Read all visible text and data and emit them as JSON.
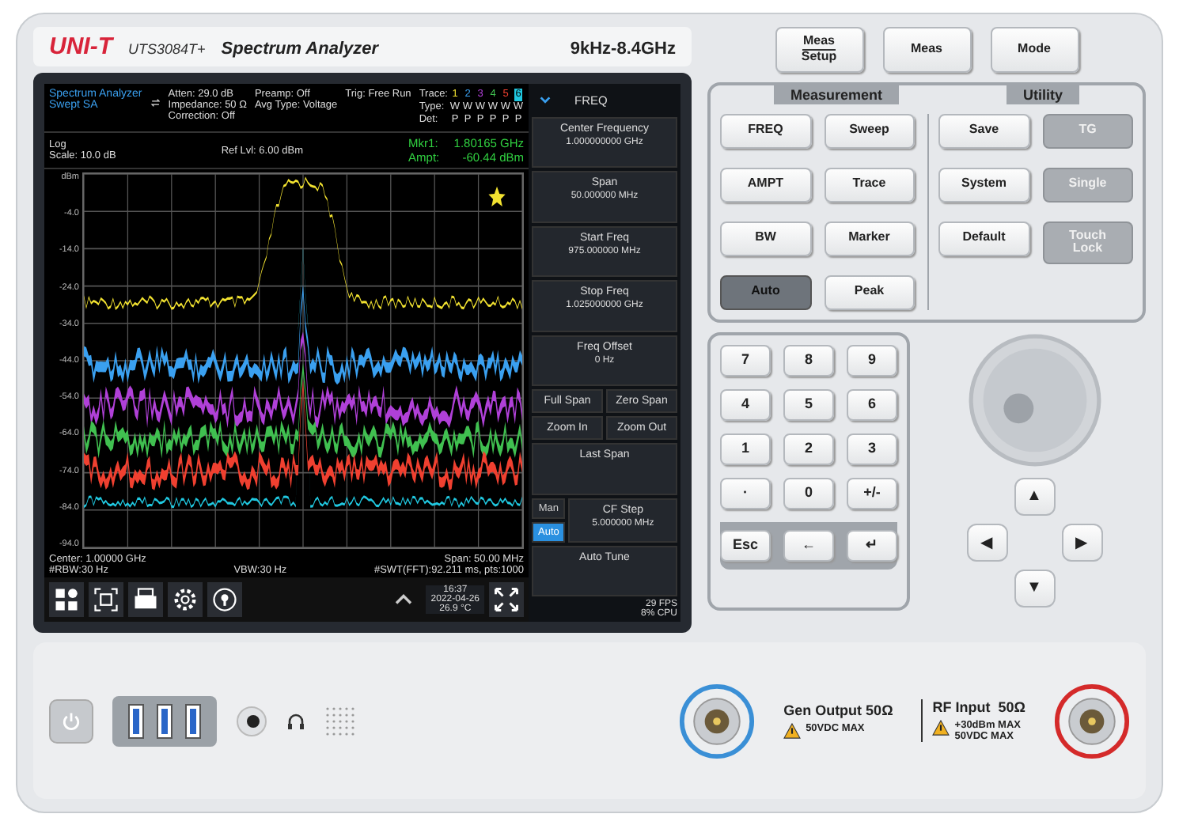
{
  "header": {
    "brand": "UNI-T",
    "model": "UTS3084T+",
    "product": "Spectrum Analyzer",
    "range": "9kHz-8.4GHz"
  },
  "screen": {
    "mode": [
      "Spectrum Analyzer",
      "Swept SA"
    ],
    "settings_1": [
      "Atten: 29.0 dB",
      "Impedance: 50 Ω",
      "Correction: Off"
    ],
    "settings_2": [
      "Preamp: Off",
      "Avg Type: Voltage"
    ],
    "trigger": "Trig: Free Run",
    "trace_labels": [
      "Trace:",
      "Type:",
      "Det:"
    ],
    "traces": [
      {
        "number": "1",
        "type": "W",
        "det": "P",
        "color": "#f2e230",
        "selected": false
      },
      {
        "number": "2",
        "type": "W",
        "det": "P",
        "color": "#3aa0f0",
        "selected": false
      },
      {
        "number": "3",
        "type": "W",
        "det": "P",
        "color": "#b040d8",
        "selected": false
      },
      {
        "number": "4",
        "type": "W",
        "det": "P",
        "color": "#40c050",
        "selected": false
      },
      {
        "number": "5",
        "type": "W",
        "det": "P",
        "color": "#f04030",
        "selected": false
      },
      {
        "number": "6",
        "type": "W",
        "det": "P",
        "color": "#20c8e0",
        "selected": true
      }
    ],
    "scale": [
      "Log",
      "Scale: 10.0 dB"
    ],
    "ref_level": "Ref Lvl: 6.00 dBm",
    "marker": [
      {
        "label": "Mkr1:",
        "value": "1.80165 GHz"
      },
      {
        "label": "Ampt:",
        "value": "-60.44 dBm"
      }
    ],
    "y_axis": [
      "dBm",
      "-4.0",
      "-14.0",
      "-24.0",
      "-34.0",
      "-44.0",
      "-54.0",
      "-64.0",
      "-74.0",
      "-84.0",
      "-94.0"
    ],
    "footer": {
      "center": "Center: 1.00000 GHz",
      "rbw": "#RBW:30 Hz",
      "vbw": "VBW:30 Hz",
      "span": "Span: 50.00 MHz",
      "sweep": "#SWT(FFT):92.211 ms, pts:1000"
    },
    "status": {
      "time": "16:37",
      "date": "2022-04-26",
      "temperature": "26.9 °C"
    },
    "menu": {
      "title": "FREQ",
      "items": [
        {
          "kind": "value",
          "label": "Center Frequency",
          "value": "1.000000000 GHz"
        },
        {
          "kind": "value",
          "label": "Span",
          "value": "50.000000 MHz"
        },
        {
          "kind": "value",
          "label": "Start Freq",
          "value": "975.000000 MHz"
        },
        {
          "kind": "value",
          "label": "Stop Freq",
          "value": "1.025000000 GHz"
        },
        {
          "kind": "value",
          "label": "Freq Offset",
          "value": "0 Hz"
        },
        {
          "kind": "pair",
          "buttons": [
            "Full Span",
            "Zero Span"
          ]
        },
        {
          "kind": "pair",
          "buttons": [
            "Zoom In",
            "Zoom Out"
          ]
        },
        {
          "kind": "single",
          "label": "Last Span"
        },
        {
          "kind": "step",
          "options": [
            {
              "label": "Man",
              "selected": false
            },
            {
              "label": "Auto",
              "selected": true
            }
          ],
          "label": "CF Step",
          "value": "5.000000 MHz"
        },
        {
          "kind": "single",
          "label": "Auto Tune"
        }
      ],
      "fps": "29 FPS",
      "cpu": "8% CPU"
    }
  },
  "top_keys": [
    {
      "lines": [
        "Meas",
        "Setup"
      ]
    },
    {
      "lines": [
        "Meas"
      ]
    },
    {
      "lines": [
        "Mode"
      ]
    }
  ],
  "sections": [
    "Measurement",
    "Utility"
  ],
  "measurement_columns": [
    [
      {
        "label": "FREQ",
        "kind": "light"
      },
      {
        "label": "AMPT",
        "kind": "light"
      },
      {
        "label": "BW",
        "kind": "light"
      },
      {
        "label": "Auto",
        "kind": "dark"
      }
    ],
    [
      {
        "label": "Sweep",
        "kind": "light"
      },
      {
        "label": "Trace",
        "kind": "light"
      },
      {
        "label": "Marker",
        "kind": "light"
      },
      {
        "label": "Peak",
        "kind": "light"
      }
    ]
  ],
  "utility_columns": [
    [
      {
        "label": "Save",
        "kind": "light"
      },
      {
        "label": "System",
        "kind": "light"
      },
      {
        "label": "Default",
        "kind": "light"
      }
    ],
    [
      {
        "label": "TG",
        "kind": "grey"
      },
      {
        "label": "Single",
        "kind": "grey"
      },
      {
        "label": "Touch Lock",
        "kind": "grey"
      }
    ]
  ],
  "keypad": [
    "7",
    "8",
    "9",
    "4",
    "5",
    "6",
    "1",
    "2",
    "3",
    "·",
    "0",
    "+/-"
  ],
  "edit_keys": [
    "Esc",
    "←",
    "↵"
  ],
  "arrows": [
    "▲",
    "◀",
    "▶",
    "▼"
  ],
  "connectors": [
    {
      "label": "Gen Output 50Ω",
      "warnings": [
        "50VDC MAX"
      ],
      "color": "#3a8fd6"
    },
    {
      "label": "RF Input  50Ω",
      "warnings": [
        "+30dBm MAX",
        "50VDC MAX"
      ],
      "color": "#d42a2a"
    }
  ]
}
